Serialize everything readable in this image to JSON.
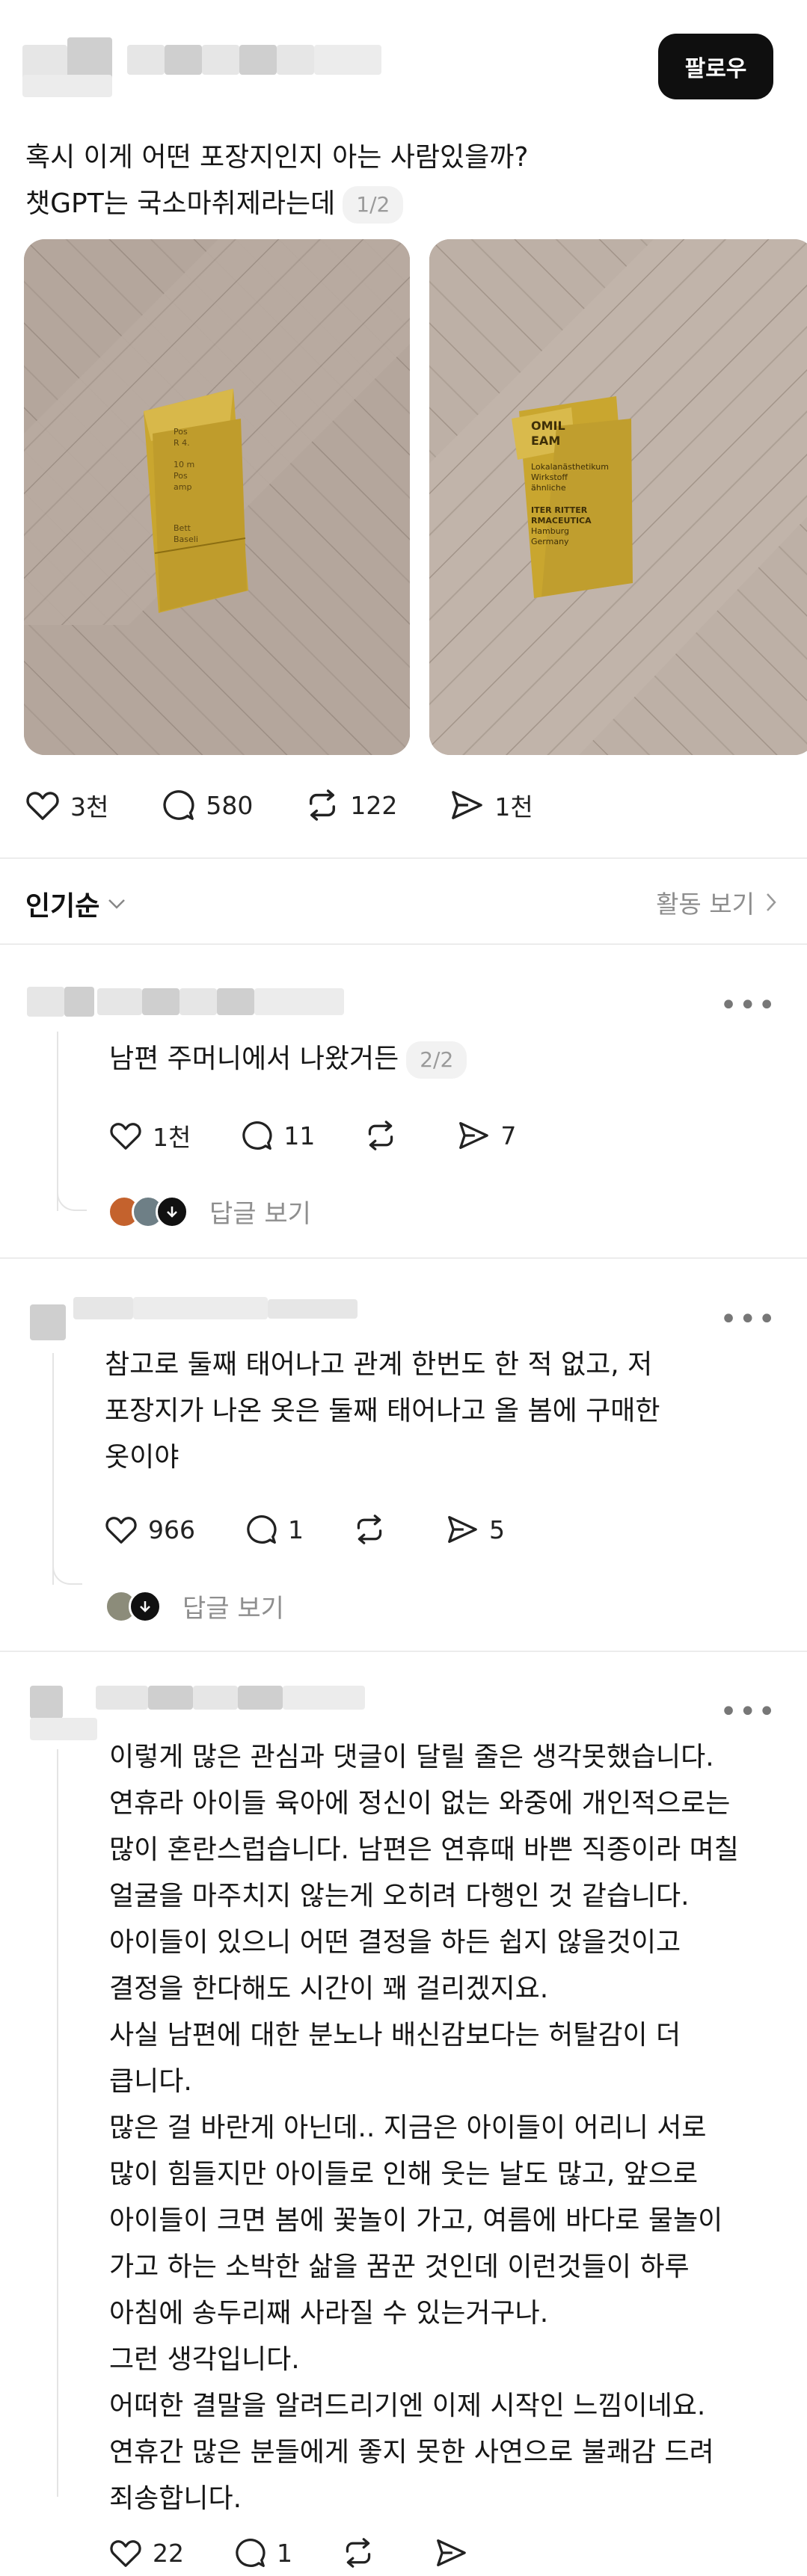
{
  "post": {
    "follow_label": "팔로우",
    "text": "혹시 이게 어떤 포장지인지 아는 사람있을까?\n챗GPT는 국소마취제라는데",
    "page_indicator": "1/2",
    "likes": "3천",
    "comments": "580",
    "reposts": "122",
    "shares": "1천"
  },
  "sort": {
    "label": "인기순",
    "activity_label": "활동 보기"
  },
  "comments": [
    {
      "text": "남편 주머니에서 나왔거든",
      "page_indicator": "2/2",
      "likes": "1천",
      "replies": "11",
      "shares": "7",
      "reply_label": "답글 보기"
    },
    {
      "text": "참고로 둘째 태어나고 관계 한번도 한 적 없고, 저\n포장지가 나온 옷은 둘째 태어나고 올 봄에 구매한\n옷이야",
      "likes": "966",
      "replies": "1",
      "shares": "5",
      "reply_label": "답글 보기"
    },
    {
      "text": "이렇게 많은 관심과 댓글이 달릴 줄은 생각못했습니다.\n연휴라 아이들 육아에 정신이 없는 와중에 개인적으로는\n많이 혼란스럽습니다. 남편은 연휴때 바쁜 직종이라 며칠\n얼굴을 마주치지 않는게 오히려 다행인 것 같습니다.\n아이들이 있으니 어떤 결정을 하든 쉽지 않을것이고\n결정을 한다해도 시간이 꽤 걸리겠지요.\n사실 남편에 대한 분노나 배신감보다는 허탈감이 더\n큽니다.\n많은 걸 바란게 아닌데.. 지금은 아이들이 어리니 서로\n많이 힘들지만 아이들로 인해 웃는 날도 많고, 앞으로\n아이들이 크면 봄에 꽃놀이 가고, 여름에 바다로 물놀이\n가고 하는 소박한  삶을 꿈꾼 것인데 이런것들이 하루\n아침에 송두리째 사라질 수 있는거구나.\n그런 생각입니다.\n어떠한 결말을 알려드리기엔 이제 시작인 느낌이네요.\n연휴간 많은 분들에게 좋지 못한 사연으로 불쾌감 드려\n죄송합니다.",
      "likes": "22",
      "replies": "1"
    }
  ],
  "packet_left": {
    "lines": [
      "Pos",
      "R 4.",
      "10 m",
      "Pos",
      "amp",
      "Bett",
      "Baseli"
    ]
  },
  "packet_right": {
    "lines": [
      "OMIL",
      "EAM",
      "Lokalanästhetikum",
      "Wirkstoff",
      "ähnliche",
      "ITER RITTER",
      "RMACEUTICA",
      "Hamburg",
      "Germany"
    ]
  },
  "colors": {
    "accent": "#0f0f0f",
    "muted": "#8e8e8e",
    "divider": "#ececec",
    "couch": "#b5a79d",
    "gold": "#c9a62f"
  }
}
